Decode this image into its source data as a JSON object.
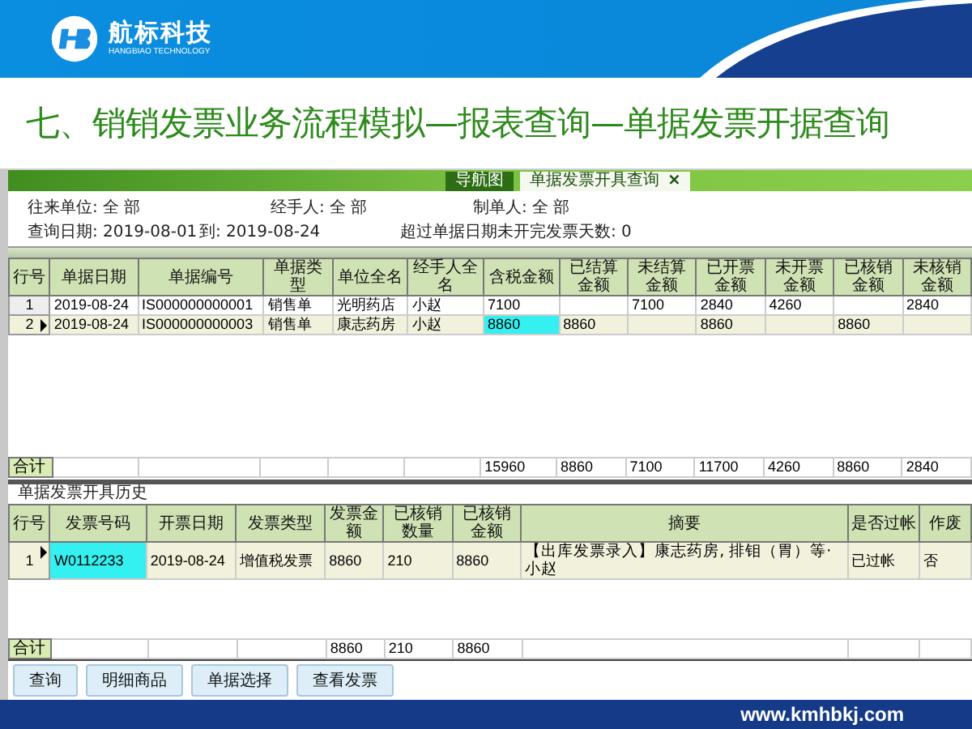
{
  "brand": {
    "name": "航标科技",
    "tagline": "HANGBIAO TECHNOLOGY"
  },
  "slide_title": "七、销销发票业务流程模拟—报表查询—单据发票开据查询",
  "tabs": [
    {
      "label": "导航图",
      "selected": false,
      "closable": false
    },
    {
      "label": "单据发票开具查询",
      "selected": true,
      "closable": true,
      "close": "×"
    }
  ],
  "filters": [
    [
      {
        "label": "往来单位:",
        "value": "全 部"
      },
      {
        "label": "经手人:",
        "value": "全 部"
      },
      {
        "label": "制单人:",
        "value": "全 部"
      }
    ],
    [
      {
        "label": "查询日期:",
        "value": "2019-08-01"
      },
      {
        "label": "到:",
        "value": "2019-08-24"
      },
      {
        "label": "超过单据日期未开完发票天数:",
        "value": "0"
      }
    ]
  ],
  "documents_table": {
    "columns": [
      "行号",
      "单据日期",
      "单据编号",
      "单据类型",
      "单位全名",
      "经手人全名",
      "含税金额",
      "已结算金额",
      "未结算金额",
      "已开票金额",
      "未开票金额",
      "已核销金额",
      "未核销金额"
    ],
    "rows": [
      {
        "kind": "data",
        "selected": false,
        "cells": [
          "1",
          "2019-08-24",
          "IS000000000001",
          "销售单",
          "光明药店",
          "小赵",
          {
            "text": "7100",
            "focused": false
          },
          null,
          "7100",
          "2840",
          "4260",
          null,
          "2840"
        ]
      },
      {
        "kind": "data",
        "selected": true,
        "cells": [
          "2",
          "2019-08-24",
          "IS000000000003",
          "销售单",
          "康志药房",
          "小赵",
          {
            "text": "8860",
            "focused": true
          },
          "8860",
          null,
          "8860",
          null,
          "8860",
          null
        ]
      },
      {
        "kind": "total",
        "selected": false,
        "cells": [
          "合计",
          null,
          null,
          null,
          null,
          null,
          "15960",
          "8860",
          "7100",
          "11700",
          "4260",
          "8860",
          "2840"
        ]
      }
    ]
  },
  "history_caption": "单据发票开具历史",
  "history_table": {
    "columns": [
      "行号",
      "发票号码",
      "开票日期",
      "发票类型",
      "发票金额",
      "已核销数量",
      "已核销金额",
      "摘要",
      "是否过帐",
      "作废"
    ],
    "rows": [
      {
        "kind": "data",
        "selected": true,
        "cells": [
          "1",
          {
            "text": "W0112233",
            "focused": true
          },
          "2019-08-24",
          "增值税发票",
          "8860",
          "210",
          "8860",
          "【出库发票录入】康志药房, 排钼（胃）等·小赵",
          "已过帐",
          "否"
        ]
      },
      {
        "kind": "total",
        "selected": false,
        "cells": [
          "合计",
          null,
          null,
          null,
          "8860",
          "210",
          "8860",
          null,
          null,
          null
        ]
      }
    ]
  },
  "buttons": [
    "查询",
    "明细商品",
    "单据选择",
    "查看发票"
  ],
  "footer_url": "www.kmhbkj.com"
}
